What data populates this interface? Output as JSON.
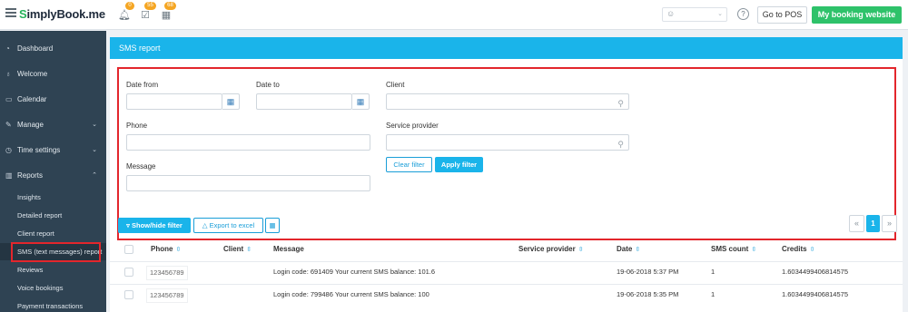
{
  "topbar": {
    "logo_s": "S",
    "logo_rest": "implyBook.me",
    "notifications": [
      {
        "icon": "bell-icon",
        "glyph": "🔔︎",
        "badge": "0"
      },
      {
        "icon": "calendar-check-icon",
        "glyph": "☑",
        "badge": "55"
      },
      {
        "icon": "calendar-icon",
        "glyph": "▦",
        "badge": "68"
      }
    ],
    "user_icon": "user-icon",
    "help": "?",
    "go_to_pos": "Go to POS",
    "my_booking_website": "My booking website",
    "colors": {
      "accent": "#2ec26a",
      "badge": "#f5a623"
    }
  },
  "sidebar": {
    "items": [
      {
        "label": "Dashboard",
        "icon": "dashboard-icon",
        "glyph": "◔",
        "chevron": ""
      },
      {
        "label": "Welcome",
        "icon": "lightbulb-icon",
        "glyph": "♁",
        "chevron": ""
      },
      {
        "label": "Calendar",
        "icon": "calendar-icon",
        "glyph": "▭",
        "chevron": ""
      },
      {
        "label": "Manage",
        "icon": "pencil-icon",
        "glyph": "✎",
        "chevron": "⌄"
      },
      {
        "label": "Time settings",
        "icon": "clock-icon",
        "glyph": "◷",
        "chevron": "⌄"
      },
      {
        "label": "Reports",
        "icon": "chart-icon",
        "glyph": "▥",
        "chevron": "⌃"
      }
    ],
    "sub_items": [
      {
        "label": "Insights"
      },
      {
        "label": "Detailed report"
      },
      {
        "label": "Client report"
      },
      {
        "label": "SMS (text messages) report"
      },
      {
        "label": "Reviews"
      },
      {
        "label": "Voice bookings"
      },
      {
        "label": "Payment transactions"
      }
    ]
  },
  "panel": {
    "title": "SMS report",
    "filters": {
      "date_from_label": "Date from",
      "date_to_label": "Date to",
      "client_label": "Client",
      "phone_label": "Phone",
      "service_provider_label": "Service provider",
      "message_label": "Message",
      "clear_filter": "Clear filter",
      "apply_filter": "Apply filter"
    },
    "toolbar": {
      "show_hide_filter": "Show/hide filter",
      "export_to_excel": "Export to excel",
      "pager_prev": "«",
      "pager_current": "1",
      "pager_next": "»"
    },
    "table": {
      "columns": [
        "Phone",
        "Client",
        "Message",
        "Service provider",
        "Date",
        "SMS count",
        "Credits"
      ],
      "sort_glyph": "⇳",
      "rows": [
        {
          "phone": "123456789",
          "client": "",
          "message": "Login code: 691409 Your current SMS balance: 101.6",
          "service_provider": "",
          "date": "19-06-2018 5:37 PM",
          "sms_count": "1",
          "credits": "1.6034499406814575"
        },
        {
          "phone": "123456789",
          "client": "",
          "message": "Login code: 799486 Your current SMS balance: 100",
          "service_provider": "",
          "date": "19-06-2018 5:35 PM",
          "sms_count": "1",
          "credits": "1.6034499406814575"
        }
      ]
    }
  }
}
